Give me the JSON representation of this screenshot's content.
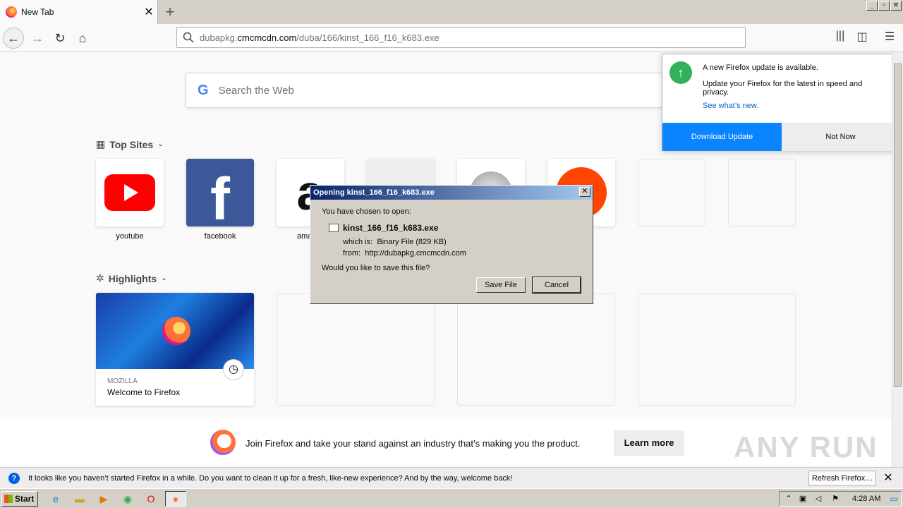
{
  "browser": {
    "tab_title": "New Tab",
    "new_tab_symbol": "+",
    "url_domain_prefix": "dubapkg.",
    "url_domain": "cmcmcdn.com",
    "url_path": "/duba/166/kinst_166_f16_k683.exe"
  },
  "newtab": {
    "search_placeholder": "Search the Web",
    "top_sites_title": "Top Sites",
    "highlights_title": "Highlights",
    "top_sites": [
      {
        "label": "youtube"
      },
      {
        "label": "facebook"
      },
      {
        "label": "ama"
      }
    ],
    "highlight": {
      "source": "MOZILLA",
      "title": "Welcome to Firefox"
    }
  },
  "update_panel": {
    "heading": "A new Firefox update is available.",
    "body": "Update your Firefox for the latest in speed and privacy.",
    "link": "See what’s new.",
    "download_label": "Download Update",
    "not_now_label": "Not Now"
  },
  "dialog": {
    "title": "Opening kinst_166_f16_k683.exe",
    "intro": "You have chosen to open:",
    "filename": "kinst_166_f16_k683.exe",
    "which_is_label": "which is:",
    "which_is_value": "Binary File (829 KB)",
    "from_label": "from:",
    "from_value": "http://dubapkg.cmcmcdn.com",
    "question": "Would you like to save this file?",
    "save_label": "Save File",
    "cancel_label": "Cancel"
  },
  "promo": {
    "text": "Join Firefox and take your stand against an industry that’s making you the product.",
    "button": "Learn more"
  },
  "watermark": "ANY RUN",
  "notification": {
    "text": "It looks like you haven’t started Firefox in a while. Do you want to clean it up for a fresh, like-new experience? And by the way, welcome back!",
    "button": "Refresh Firefox…"
  },
  "taskbar": {
    "start_label": "Start",
    "clock": "4:28 AM"
  }
}
